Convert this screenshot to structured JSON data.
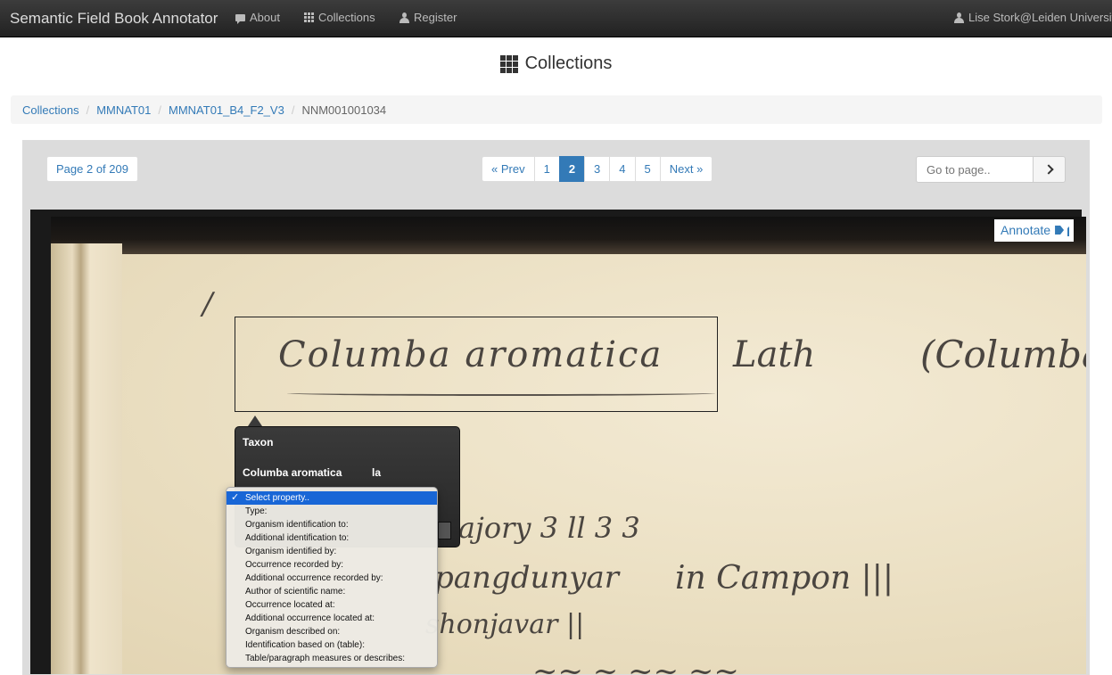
{
  "navbar": {
    "brand": "Semantic Field Book Annotator",
    "about": "About",
    "collections": "Collections",
    "register": "Register",
    "user": "Lise Stork@Leiden University"
  },
  "page_title": "Collections",
  "breadcrumb": [
    "Collections",
    "MMNAT01",
    "MMNAT01_B4_F2_V3",
    "NNM001001034"
  ],
  "page_count": "Page 2 of 209",
  "pagination": {
    "prev": "« Prev",
    "pages": [
      "1",
      "2",
      "3",
      "4",
      "5"
    ],
    "active": "2",
    "next": "Next »"
  },
  "goto_placeholder": "Go to page..",
  "annotate_label": "Annotate",
  "popup": {
    "title": "Taxon",
    "value": "Columba aromatica",
    "partial": "la"
  },
  "dropdown": {
    "options": [
      "Select property..",
      "Type:",
      "Organism identification to:",
      "Additional identification to:",
      "Organism identified by:",
      "Occurrence recorded by:",
      "Additional occurrence recorded by:",
      "Author of scientific name:",
      "Occurrence located at:",
      "Additional occurrence located at:",
      "Organism described on:",
      "Identification based on (table):",
      "Table/paragraph measures or describes:"
    ],
    "selected_index": 0
  },
  "icons": {
    "about": "comment-icon",
    "collections": "grid-icon",
    "register": "user-icon",
    "user": "user-icon",
    "annotate": "tags-icon",
    "goto": "chevron-right-icon"
  },
  "colors": {
    "link": "#337ab7",
    "navbar": "#222222",
    "selected_option": "#1866d6"
  }
}
